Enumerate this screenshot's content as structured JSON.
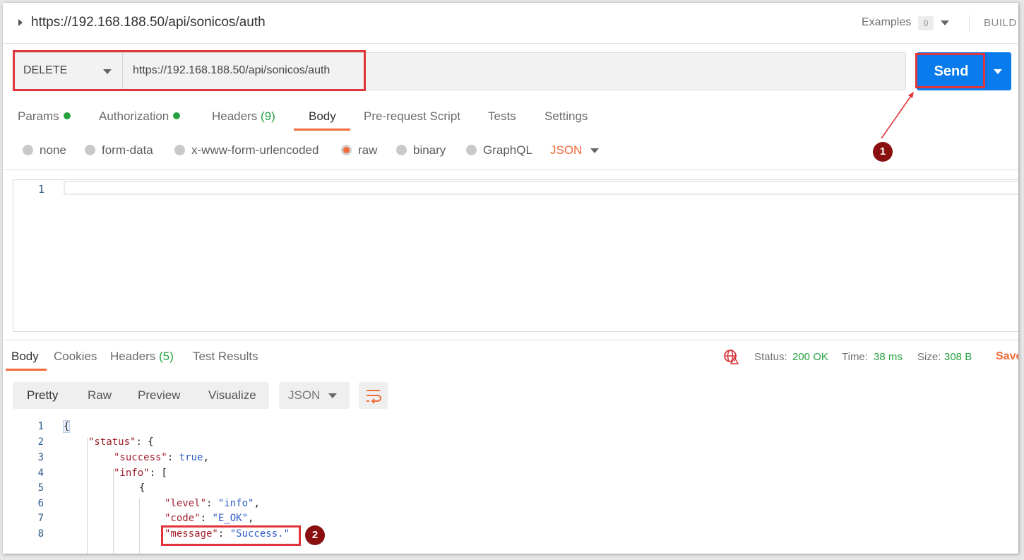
{
  "title_bar": {
    "request_url": "https://192.168.188.50/api/sonicos/auth",
    "examples_label": "Examples",
    "examples_count": "0",
    "build_label": "BUILD"
  },
  "request": {
    "method": "DELETE",
    "url": "https://192.168.188.50/api/sonicos/auth",
    "send_label": "Send"
  },
  "request_tabs": {
    "params": "Params",
    "authorization": "Authorization",
    "headers": "Headers",
    "headers_count": "(9)",
    "body": "Body",
    "prerequest": "Pre-request Script",
    "tests": "Tests",
    "settings": "Settings",
    "active": "Body"
  },
  "body_modes": {
    "none": "none",
    "form_data": "form-data",
    "urlencoded": "x-www-form-urlencoded",
    "raw": "raw",
    "binary": "binary",
    "graphql": "GraphQL",
    "format": "JSON",
    "selected": "raw"
  },
  "request_editor": {
    "line_numbers": [
      "1"
    ]
  },
  "response_tabs": {
    "body": "Body",
    "cookies": "Cookies",
    "headers": "Headers",
    "headers_count": "(5)",
    "test_results": "Test Results",
    "active": "Body"
  },
  "response_status": {
    "status_label": "Status:",
    "status_value": "200 OK",
    "time_label": "Time:",
    "time_value": "38 ms",
    "size_label": "Size:",
    "size_value": "308 B",
    "save_label": "Save"
  },
  "response_view": {
    "pretty": "Pretty",
    "raw": "Raw",
    "preview": "Preview",
    "visualize": "Visualize",
    "format": "JSON",
    "active": "Pretty"
  },
  "response_body": {
    "lines": [
      {
        "n": "1",
        "text": "{"
      },
      {
        "n": "2",
        "key": "\"status\"",
        "rest": ": {"
      },
      {
        "n": "3",
        "key": "\"success\"",
        "rest": ": ",
        "val": "true",
        "tail": ","
      },
      {
        "n": "4",
        "key": "\"info\"",
        "rest": ": ["
      },
      {
        "n": "5",
        "text": "{"
      },
      {
        "n": "6",
        "key": "\"level\"",
        "rest": ": ",
        "val": "\"info\"",
        "tail": ","
      },
      {
        "n": "7",
        "key": "\"code\"",
        "rest": ": ",
        "val": "\"E_OK\"",
        "tail": ","
      },
      {
        "n": "8",
        "key": "\"message\"",
        "rest": ": ",
        "val": "\"Success.\"",
        "tail": ""
      }
    ]
  },
  "annotations": {
    "badge_1": "1",
    "badge_2": "2",
    "highlight_color": "#e0353b",
    "badge_color": "#8a1010"
  },
  "colors": {
    "accent_orange": "#f26b3a",
    "send_blue": "#097bed",
    "success_green": "#26a140"
  }
}
